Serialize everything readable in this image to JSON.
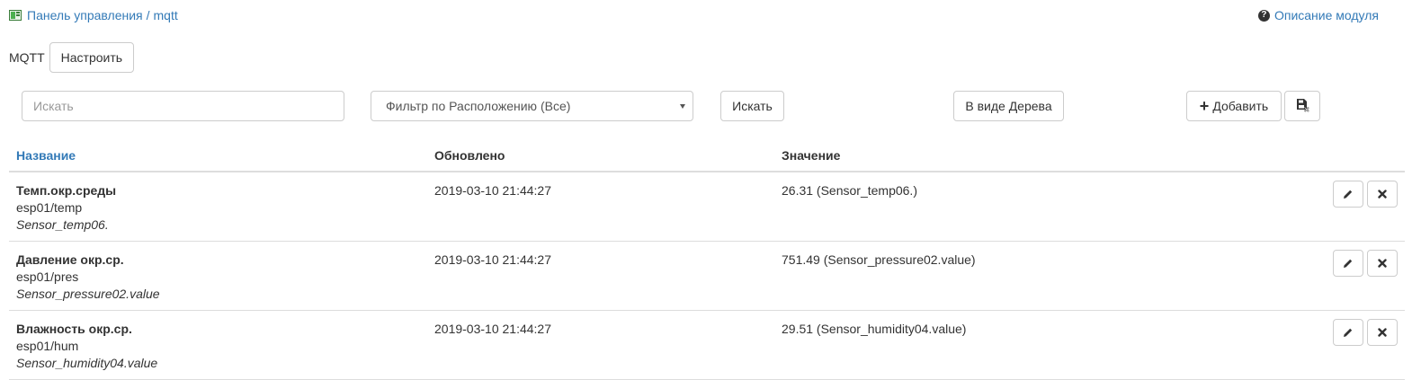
{
  "breadcrumb": {
    "home_label": "Панель управления",
    "separator": "/",
    "current": "mqtt"
  },
  "help_link": {
    "label": "Описание модуля"
  },
  "module": {
    "label": "MQTT",
    "configure_button": "Настроить"
  },
  "toolbar": {
    "search_placeholder": "Искать",
    "location_filter": "Фильтр по Расположению (Все)",
    "search_button": "Искать",
    "tree_view_button": "В виде Дерева",
    "add_button": "Добавить"
  },
  "table": {
    "headers": {
      "name": "Название",
      "updated": "Обновлено",
      "value": "Значение"
    },
    "rows": [
      {
        "title": "Темп.окр.среды",
        "topic": "esp01/temp",
        "linked": "Sensor_temp06.",
        "updated": "2019-03-10 21:44:27",
        "value": "26.31 (Sensor_temp06.)"
      },
      {
        "title": "Давление окр.ср.",
        "topic": "esp01/pres",
        "linked": "Sensor_pressure02.value",
        "updated": "2019-03-10 21:44:27",
        "value": "751.49 (Sensor_pressure02.value)"
      },
      {
        "title": "Влажность окр.ср.",
        "topic": "esp01/hum",
        "linked": "Sensor_humidity04.value",
        "updated": "2019-03-10 21:44:27",
        "value": "29.51 (Sensor_humidity04.value)"
      }
    ]
  },
  "icons": {
    "home": "control-panel-icon",
    "help": "question-circle-icon",
    "add": "plus-icon",
    "export": "export-icon",
    "edit": "pencil-icon",
    "delete": "remove-icon"
  },
  "colors": {
    "link": "#337ab7",
    "border": "#cccccc",
    "divider": "#dddddd"
  }
}
